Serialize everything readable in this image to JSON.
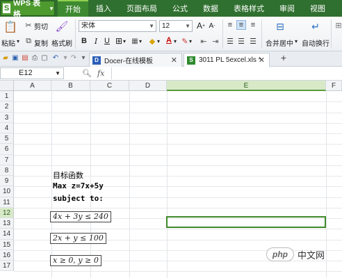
{
  "app": {
    "name": "WPS 表格",
    "logo_letter": "S"
  },
  "menus": [
    "开始",
    "插入",
    "页面布局",
    "公式",
    "数据",
    "表格样式",
    "审阅",
    "视图"
  ],
  "ribbon": {
    "paste": "粘贴",
    "cut": "剪切",
    "copy": "复制",
    "format_painter": "格式刷",
    "font_name": "宋体",
    "font_size": "12",
    "bold": "B",
    "italic": "I",
    "underline": "U",
    "merge_center": "合并居中",
    "wrap_text": "自动换行"
  },
  "tabs": [
    {
      "label": "Docer-在线模板",
      "active": false
    },
    {
      "label": "3011 PL 5excel.xls *",
      "active": true
    }
  ],
  "formula_bar": {
    "cell_ref": "E12",
    "fx": "fx",
    "value": ""
  },
  "columns": [
    "A",
    "B",
    "C",
    "D",
    "E",
    "F"
  ],
  "rows": [
    "1",
    "2",
    "3",
    "4",
    "5",
    "6",
    "7",
    "8",
    "9",
    "10",
    "11",
    "12",
    "13",
    "14",
    "15",
    "16",
    "17"
  ],
  "selected": {
    "column": "E",
    "row": "12"
  },
  "cells": {
    "b8": "目标函数",
    "b9": "Max z=7x+5y",
    "b10": "subject to:",
    "eq1": "4x + 3y ≤ 240",
    "eq2": "2x + y ≤ 100",
    "eq3": "x ≥ 0, y ≥ 0"
  },
  "watermark": {
    "logo": "php",
    "text": "中文网"
  },
  "colors": {
    "menubar": "#2f6f2f",
    "selection": "#3f8a2a",
    "selected_header": "#d8e9c8"
  }
}
